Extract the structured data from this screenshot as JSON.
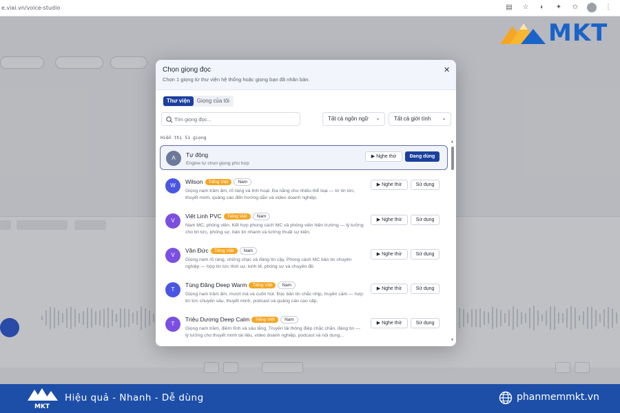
{
  "browser": {
    "url": "e.viai.vn/voice-studio"
  },
  "brand": {
    "logo_text": "MKT",
    "accent": "#1c3f9e",
    "badge_color": "#f5a623",
    "footer_color": "#1d4fa8"
  },
  "modal": {
    "title": "Chọn giọng đọc",
    "subtitle": "Chọn 1 giọng từ thư viện hệ thống hoặc giọng bạn đã nhân bản.",
    "tabs": [
      "Thư viện",
      "Giọng của tôi"
    ],
    "search_placeholder": "Tìm giọng đọc...",
    "filter_language": "Tất cả ngôn ngữ",
    "filter_gender": "Tất cả giới tính",
    "count_label": "Hiển thị 51 giọng",
    "listen_label": "Nghe thử",
    "use_label": "Sử dụng",
    "using_label": "Đang dùng",
    "voices": [
      {
        "initial": "A",
        "name": "Tự động",
        "lang": "",
        "gender": "",
        "desc": "Engine tự chọn giọng phù hợp",
        "color": "#6b7a99",
        "selected": true
      },
      {
        "initial": "W",
        "name": "Wilson",
        "lang": "Tiếng Việt",
        "gender": "Nam",
        "desc": "Giọng nam trầm ấm, rõ ràng và linh hoạt. Đa năng cho nhiều thể loại — từ tin tức, thuyết minh, quảng cáo đến hướng dẫn và video doanh nghiệp.",
        "color": "#4a56e2",
        "selected": false
      },
      {
        "initial": "V",
        "name": "Việt Linh PVC",
        "lang": "Tiếng Việt",
        "gender": "Nam",
        "desc": "Nam MC, phóng viên. Kết hợp phong cách MC và phóng viên hiện trường — lý tưởng cho tin tức, phóng sự, bản tin nhanh và tường thuật sự kiện.",
        "color": "#7b4fe0",
        "selected": false
      },
      {
        "initial": "V",
        "name": "Văn Đức",
        "lang": "Tiếng Việt",
        "gender": "Nam",
        "desc": "Giọng nam rõ ràng, chững chạc và đáng tin cậy. Phong cách MC bản tin chuyên nghiệp — hợp tin tức thời sự, kinh tế, phóng sự và chuyên đề.",
        "color": "#7b4fe0",
        "selected": false
      },
      {
        "initial": "T",
        "name": "Tùng Đăng Deep Warm",
        "lang": "Tiếng Việt",
        "gender": "Nam",
        "desc": "Giọng nam trầm ấm, mượt mà và cuốn hút. Đọc bản tin chắc nhịp, truyền cảm — hợp tin tức chuyên sâu, thuyết minh, podcast và quảng cáo cao cấp.",
        "color": "#4a56e2",
        "selected": false
      },
      {
        "initial": "T",
        "name": "Triệu Dương Deep Calm",
        "lang": "Tiếng Việt",
        "gender": "Nam",
        "desc": "Giọng nam trầm, điềm tĩnh và sâu lắng. Truyền tải thông điệp chắc chắn, đáng tin — lý tưởng cho thuyết minh tài liệu, video doanh nghiệp, podcast và nội dung...",
        "color": "#7b4fe0",
        "selected": false
      }
    ]
  },
  "footer": {
    "slogan": "Hiệu quả - Nhanh - Dễ dùng",
    "website": "phanmemmkt.vn"
  }
}
